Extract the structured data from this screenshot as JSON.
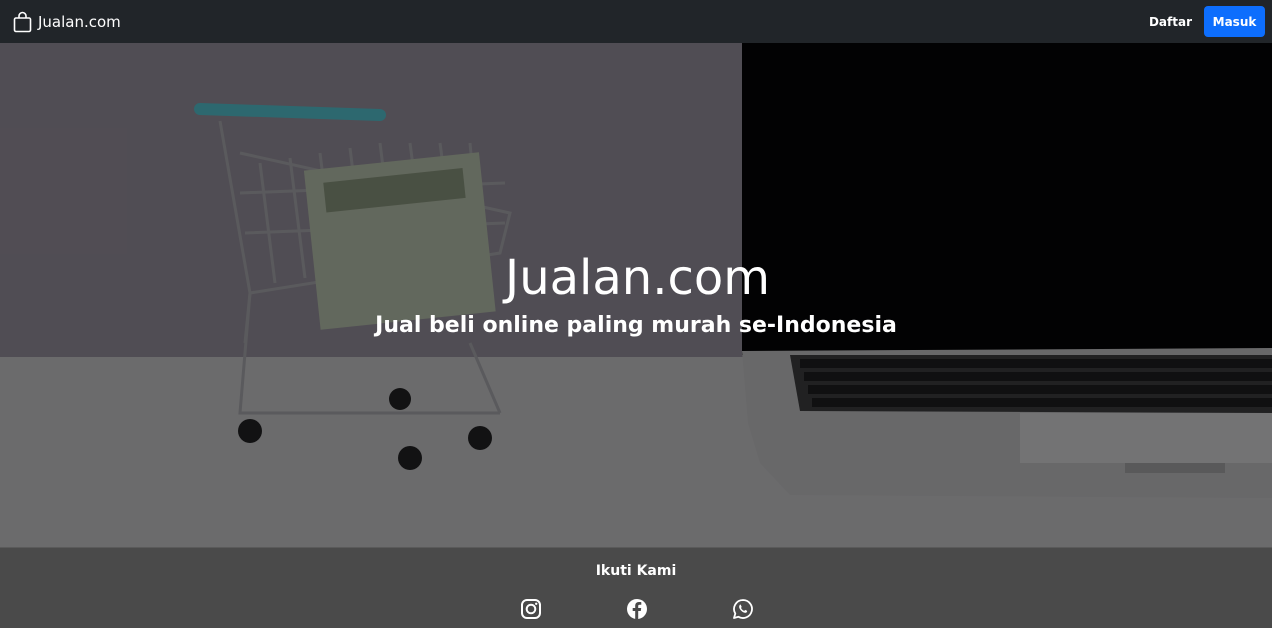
{
  "navbar": {
    "brand_icon": "shopping-bag-icon",
    "brand_label": "Jualan.com",
    "daftar_label": "Daftar",
    "masuk_label": "Masuk",
    "masuk_color": "#0d6efd"
  },
  "hero": {
    "title": "Jualan.com",
    "subtitle": "Jual beli online paling murah se-Indonesia"
  },
  "footer": {
    "title": "Ikuti Kami",
    "socials": [
      {
        "icon": "instagram-icon"
      },
      {
        "icon": "facebook-icon"
      },
      {
        "icon": "whatsapp-icon"
      }
    ]
  }
}
